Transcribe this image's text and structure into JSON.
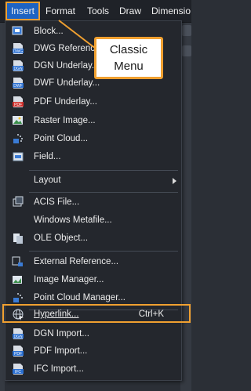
{
  "menubar": {
    "items": [
      "Insert",
      "Format",
      "Tools",
      "Draw",
      "Dimensio"
    ]
  },
  "callout": {
    "line1": "Classic",
    "line2": "Menu"
  },
  "menu": {
    "items": [
      {
        "label": "Block...",
        "icon": "block-icon"
      },
      {
        "label": "DWG Reference...",
        "icon": "dwg-icon",
        "badge": "DWG"
      },
      {
        "label": "DGN Underlay...",
        "icon": "dgn-icon",
        "badge": "DGN"
      },
      {
        "label": "DWF Underlay...",
        "icon": "dwf-icon",
        "badge": "DWF"
      },
      {
        "label": "PDF Underlay...",
        "icon": "pdf-icon",
        "badge": "PDF"
      },
      {
        "label": "Raster Image...",
        "icon": "raster-image-icon"
      },
      {
        "label": "Point Cloud...",
        "icon": "point-cloud-icon"
      },
      {
        "label": "Field...",
        "icon": "field-icon"
      },
      {
        "label": "Layout",
        "icon": "",
        "submenu": true
      },
      {
        "label": "ACIS File...",
        "icon": "acis-icon"
      },
      {
        "label": "Windows Metafile...",
        "icon": ""
      },
      {
        "label": "OLE Object...",
        "icon": "ole-icon"
      },
      {
        "label": "External Reference...",
        "icon": "xref-icon"
      },
      {
        "label": "Image Manager...",
        "icon": "image-manager-icon"
      },
      {
        "label": "Point Cloud Manager...",
        "icon": "point-cloud-manager-icon"
      },
      {
        "label": "Hyperlink...",
        "icon": "hyperlink-icon",
        "shortcut": "Ctrl+K"
      },
      {
        "label": "DGN Import...",
        "icon": "dgn-import-icon",
        "badge": "DGN"
      },
      {
        "label": "PDF Import...",
        "icon": "pdf-import-icon",
        "badge": "PDF"
      },
      {
        "label": "IFC Import...",
        "icon": "ifc-import-icon",
        "badge": "IFC"
      }
    ]
  },
  "colors": {
    "accent": "#f0a030",
    "active_menu": "#1e63c2"
  }
}
